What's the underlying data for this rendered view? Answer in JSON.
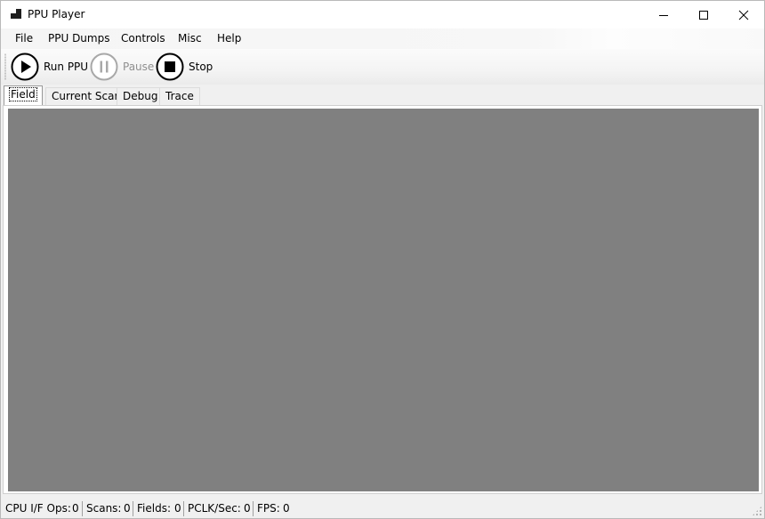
{
  "window": {
    "title": "PPU Player"
  },
  "menu": {
    "items": [
      {
        "label": "File"
      },
      {
        "label": "PPU Dumps"
      },
      {
        "label": "Controls"
      },
      {
        "label": "Misc"
      },
      {
        "label": "Help"
      }
    ]
  },
  "toolbar": {
    "run_label": "Run PPU",
    "pause_label": "Pause",
    "stop_label": "Stop"
  },
  "tabs": [
    {
      "label": "Field",
      "active": true
    },
    {
      "label": "Current Scan",
      "active": false
    },
    {
      "label": "Debug",
      "active": false
    },
    {
      "label": "Trace",
      "active": false
    }
  ],
  "status": {
    "cpu_if_ops_label": "CPU I/F Ops:",
    "cpu_if_ops_value": "0",
    "scans_label": "Scans:",
    "scans_value": "0",
    "fields_label": "Fields:",
    "fields_value": "0",
    "pclk_label": "PCLK/Sec:",
    "pclk_value": "0",
    "fps_label": "FPS:",
    "fps_value": "0"
  },
  "colors": {
    "canvas": "#808080",
    "disabled_text": "#8f8f8f"
  },
  "icons": {
    "app": "app-icon",
    "run": "play-icon",
    "pause": "pause-icon",
    "stop": "stop-icon"
  }
}
